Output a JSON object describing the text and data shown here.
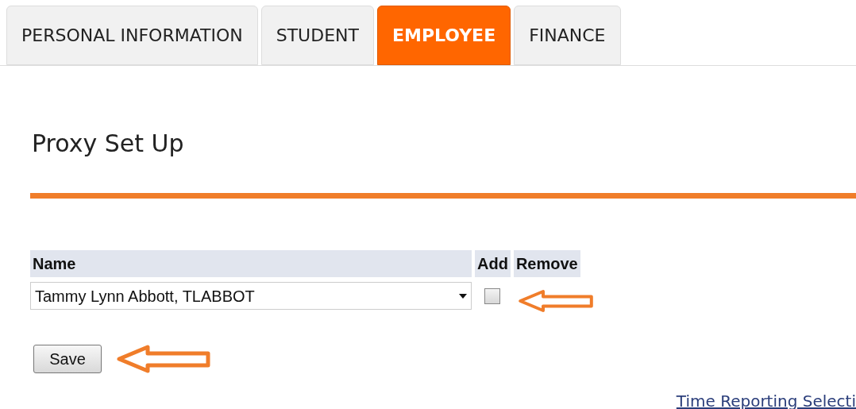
{
  "tabs": [
    {
      "label": "PERSONAL INFORMATION",
      "selected": false
    },
    {
      "label": "STUDENT",
      "selected": false
    },
    {
      "label": "EMPLOYEE",
      "selected": true
    },
    {
      "label": "FINANCE",
      "selected": false
    }
  ],
  "page_title": "Proxy Set Up",
  "table": {
    "columns": [
      "Name",
      "Add",
      "Remove"
    ],
    "rows": [
      {
        "name": "Tammy Lynn Abbott, TLABBOT",
        "add_checked": false
      }
    ]
  },
  "save_button": "Save",
  "link": "Time Reporting Selecti"
}
